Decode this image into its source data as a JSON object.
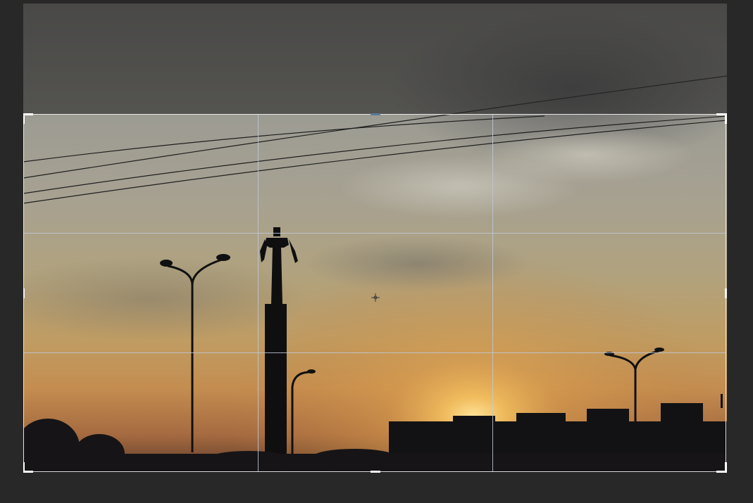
{
  "app": {
    "tool": "crop",
    "overlay": "rule-of-thirds-grid"
  },
  "colors": {
    "workspace_background": "#282828",
    "crop_border": "#e6e6e6",
    "grid_lines": "#bec8d7",
    "shield": "#282828"
  },
  "icons": {
    "center_marker": "crosshair-icon"
  }
}
